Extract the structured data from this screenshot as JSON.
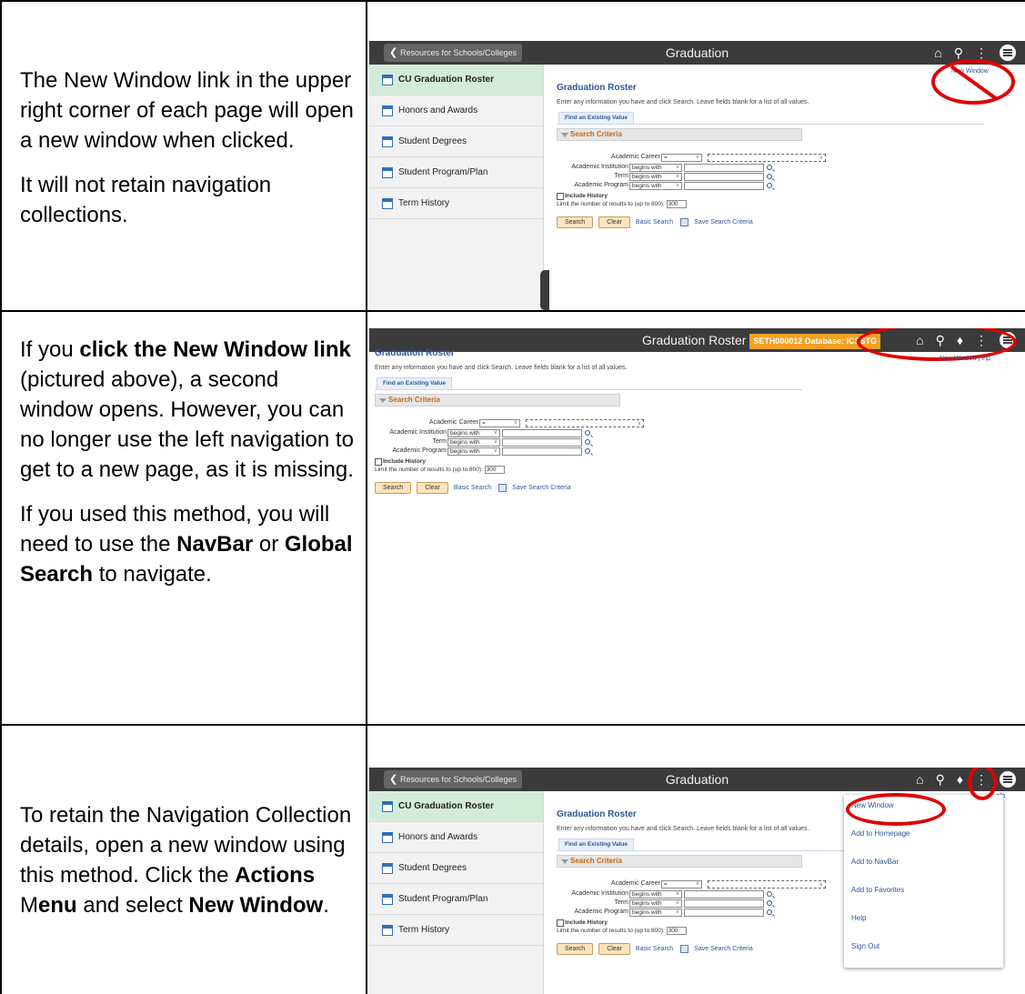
{
  "rows": [
    {
      "paragraphs": [
        "The New Window link in the upper right corner of each page will open a new window when clicked.",
        "It will not retain navigation collections."
      ]
    },
    {
      "p1": {
        "a": "If you ",
        "b": "click the New Window link",
        "c": " (pictured above), a second window opens. However, you can no longer use the left navigation to get to a new page, as it is missing."
      },
      "p2": {
        "a": "If you used this method, you will need to use the ",
        "b": "NavBar",
        "c": " or ",
        "d": "Global Search",
        "e": " to navigate."
      }
    },
    {
      "p1": {
        "a": "To retain the Navigation Collection details, open a new window using this method. Click the ",
        "b": "Actions",
        "c": " M",
        "d": "enu",
        "e": " and select ",
        "f": "New Window",
        "g": "."
      }
    }
  ],
  "app": {
    "back_label": "Resources for Schools/Colleges",
    "title": "Graduation",
    "title_2": "Graduation Roster",
    "env_badge": "SETH000012 Database: ICSSTG",
    "page_title": "Graduation Roster",
    "instructions": "Enter any information you have and click Search. Leave fields blank for a list of all values.",
    "tab_label": "Find an Existing Value",
    "criteria_label": "Search Criteria",
    "fields": [
      {
        "label": "Academic Career",
        "op": "="
      },
      {
        "label": "Academic Institution",
        "op": "begins with"
      },
      {
        "label": "Term",
        "op": "begins with"
      },
      {
        "label": "Academic Program",
        "op": "begins with"
      }
    ],
    "include_history": "Include History",
    "limit_label": "Limit the number of results to (up to 800):",
    "limit_value": "300",
    "search_btn": "Search",
    "clear_btn": "Clear",
    "basic_search": "Basic Search",
    "save_criteria": "Save Search Criteria",
    "new_window_link": "New Window",
    "help_link": "Help",
    "new_window_partial": "New Window",
    "help_partial": "elp"
  },
  "sidebar": {
    "items": [
      "CU Graduation Roster",
      "Honors and Awards",
      "Student Degrees",
      "Student Program/Plan",
      "Term History"
    ]
  },
  "actions_menu": {
    "items": [
      "New Window",
      "Add to Homepage",
      "Add to NavBar",
      "Add to Favorites",
      "Help",
      "Sign Out"
    ]
  },
  "colors": {
    "highlight_ring": "#e00000",
    "sidebar_active": "#d3ecd9",
    "env_badge": "#f4a025",
    "link": "#2f5597"
  }
}
